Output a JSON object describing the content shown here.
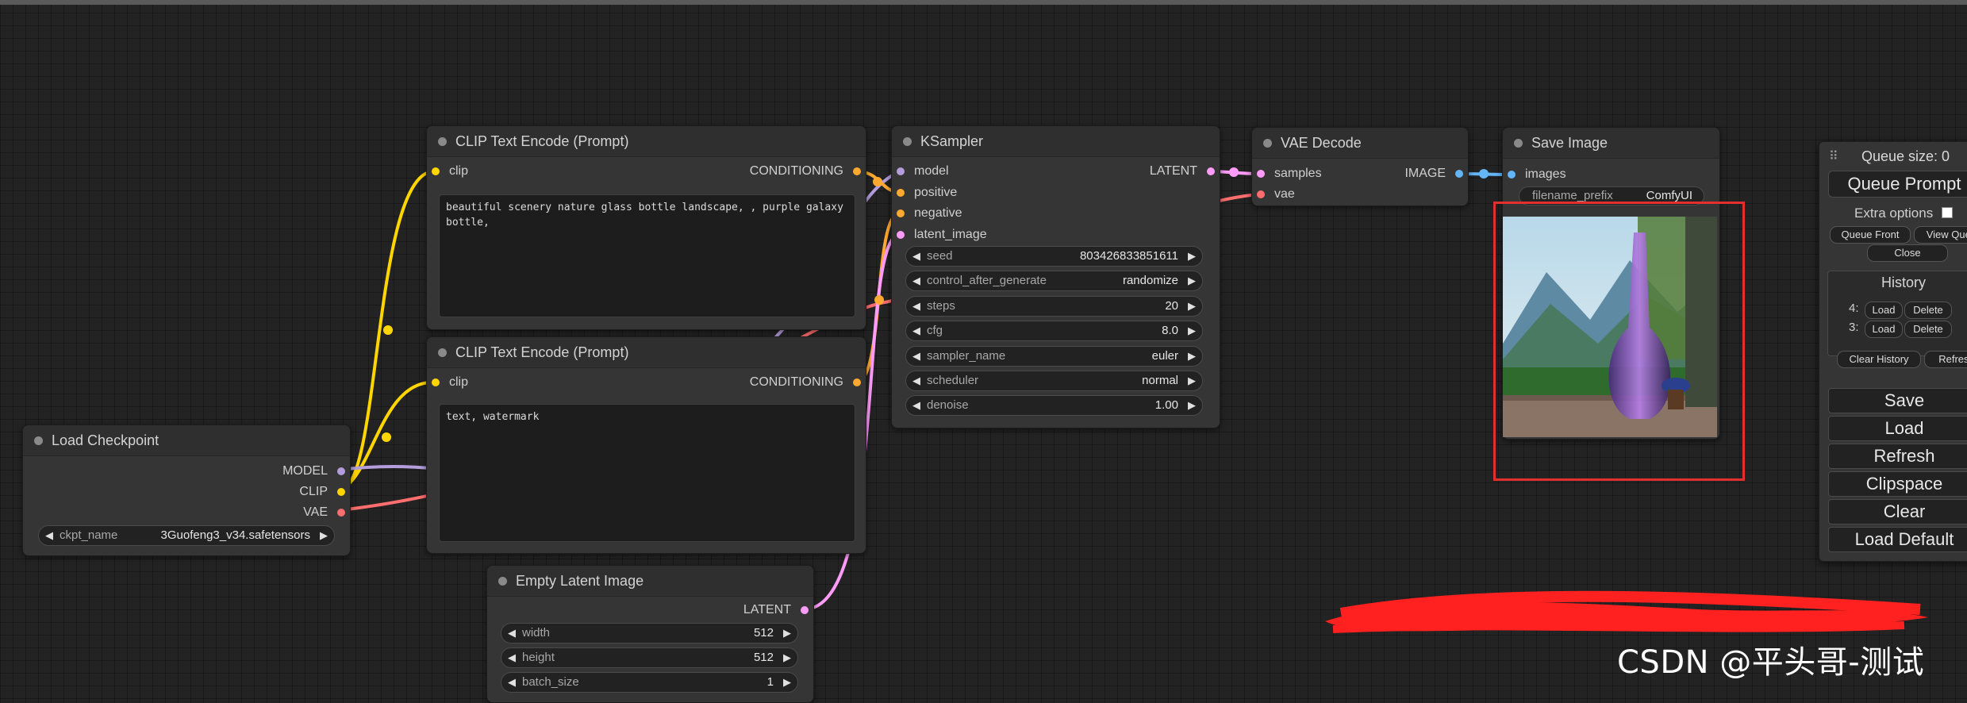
{
  "colors": {
    "model": "#b39ddb",
    "clip": "#ffd500",
    "vae": "#ff6e6e",
    "conditioning": "#ffa931",
    "latent": "#ff9cf9",
    "image": "#64b5f6",
    "highlight_box": "#e23030"
  },
  "nodes": {
    "clip_pos": {
      "title": "CLIP Text Encode (Prompt)",
      "input_clip": "clip",
      "output": "CONDITIONING",
      "text": "beautiful scenery nature glass bottle landscape, , purple galaxy bottle,"
    },
    "clip_neg": {
      "title": "CLIP Text Encode (Prompt)",
      "input_clip": "clip",
      "output": "CONDITIONING",
      "text": "text, watermark"
    },
    "ksampler": {
      "title": "KSampler",
      "inputs": [
        "model",
        "positive",
        "negative",
        "latent_image"
      ],
      "output": "LATENT",
      "widgets": [
        {
          "label": "seed",
          "value": "803426833851611"
        },
        {
          "label": "control_after_generate",
          "value": "randomize"
        },
        {
          "label": "steps",
          "value": "20"
        },
        {
          "label": "cfg",
          "value": "8.0"
        },
        {
          "label": "sampler_name",
          "value": "euler"
        },
        {
          "label": "scheduler",
          "value": "normal"
        },
        {
          "label": "denoise",
          "value": "1.00"
        }
      ]
    },
    "vae_decode": {
      "title": "VAE Decode",
      "inputs": [
        "samples",
        "vae"
      ],
      "output": "IMAGE"
    },
    "save_image": {
      "title": "Save Image",
      "input": "images",
      "filename_label": "filename_prefix",
      "filename_value": "ComfyUI"
    },
    "load_checkpoint": {
      "title": "Load Checkpoint",
      "outputs": [
        "MODEL",
        "CLIP",
        "VAE"
      ],
      "widget_label": "ckpt_name",
      "widget_value": "3Guofeng3_v34.safetensors"
    },
    "empty_latent": {
      "title": "Empty Latent Image",
      "output": "LATENT",
      "widgets": [
        {
          "label": "width",
          "value": "512"
        },
        {
          "label": "height",
          "value": "512"
        },
        {
          "label": "batch_size",
          "value": "1"
        }
      ]
    }
  },
  "menu": {
    "drag_icon": "⠿",
    "queue_size": "Queue size: 0",
    "queue_prompt": "Queue Prompt",
    "extra_options": "Extra options",
    "queue_front": "Queue Front",
    "view_queue": "View Queue",
    "close": "Close",
    "history_title": "History",
    "history": [
      {
        "index": "4:",
        "load": "Load",
        "delete": "Delete"
      },
      {
        "index": "3:",
        "load": "Load",
        "delete": "Delete"
      }
    ],
    "clear_history": "Clear History",
    "refresh_small": "Refresh",
    "buttons": [
      "Save",
      "Load",
      "Refresh",
      "Clipspace",
      "Clear",
      "Load Default"
    ]
  },
  "watermark": "CSDN @平头哥-测试"
}
